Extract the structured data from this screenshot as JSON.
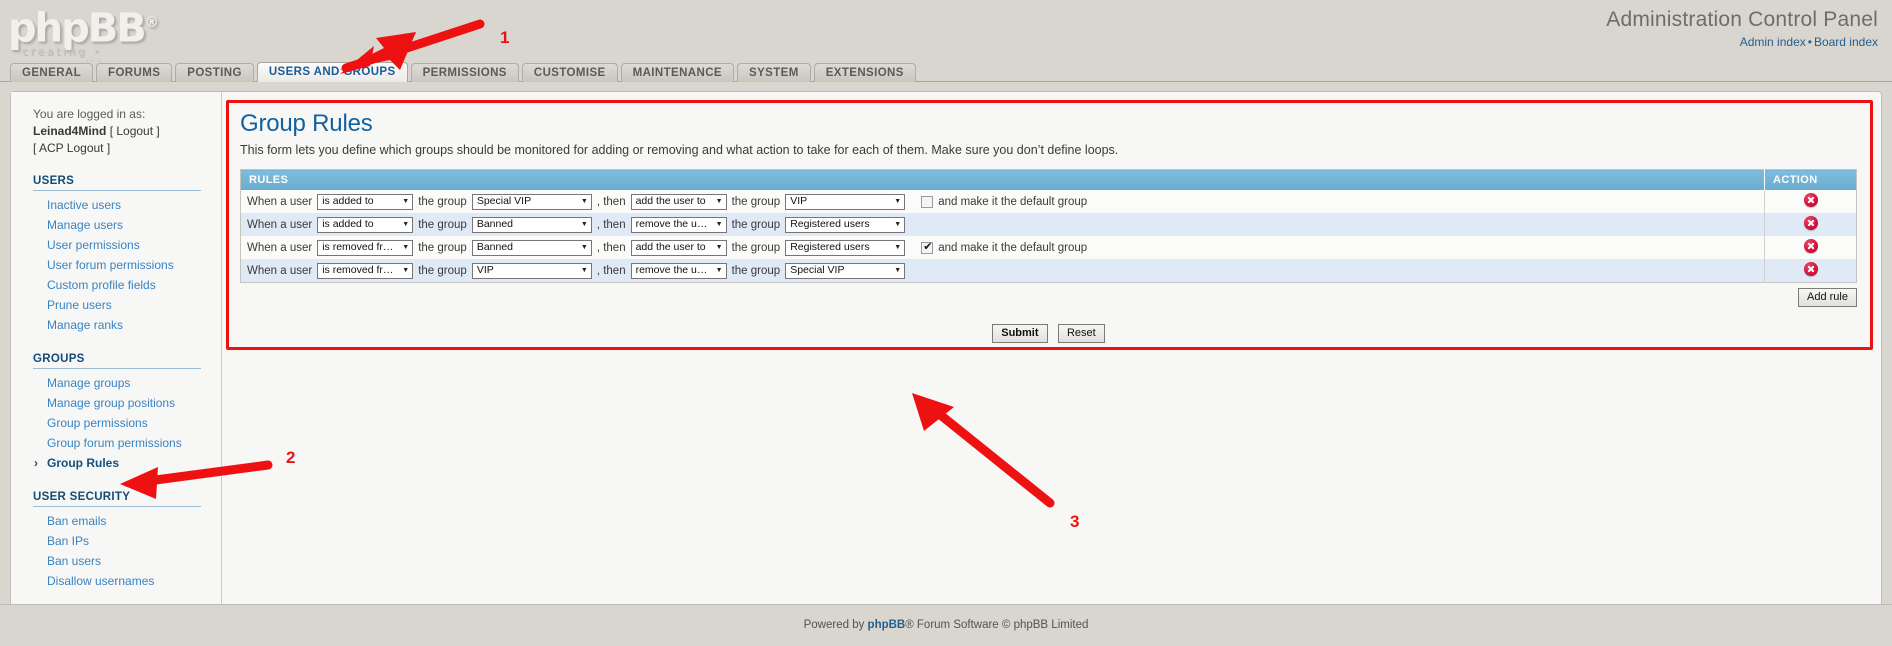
{
  "brand": {
    "logo_text": "phpBB",
    "logo_reg": "®",
    "logo_tagline": "creating • communities"
  },
  "header": {
    "acp_title": "Administration Control Panel",
    "admin_index_link": "Admin index",
    "separator": "•",
    "board_index_link": "Board index"
  },
  "tabs": [
    {
      "label": "GENERAL",
      "active": false
    },
    {
      "label": "FORUMS",
      "active": false
    },
    {
      "label": "POSTING",
      "active": false
    },
    {
      "label": "USERS AND GROUPS",
      "active": true
    },
    {
      "label": "PERMISSIONS",
      "active": false
    },
    {
      "label": "CUSTOMISE",
      "active": false
    },
    {
      "label": "MAINTENANCE",
      "active": false
    },
    {
      "label": "SYSTEM",
      "active": false
    },
    {
      "label": "EXTENSIONS",
      "active": false
    }
  ],
  "sidebar": {
    "logged_in_label": "You are logged in as:",
    "username": "Leinad4Mind",
    "logout_label": "[ Logout ]",
    "acp_logout_label": "[ ACP Logout ]",
    "sections": [
      {
        "title": "USERS",
        "items": [
          {
            "label": "Inactive users",
            "active": false
          },
          {
            "label": "Manage users",
            "active": false
          },
          {
            "label": "User permissions",
            "active": false
          },
          {
            "label": "User forum permissions",
            "active": false
          },
          {
            "label": "Custom profile fields",
            "active": false
          },
          {
            "label": "Prune users",
            "active": false
          },
          {
            "label": "Manage ranks",
            "active": false
          }
        ]
      },
      {
        "title": "GROUPS",
        "items": [
          {
            "label": "Manage groups",
            "active": false
          },
          {
            "label": "Manage group positions",
            "active": false
          },
          {
            "label": "Group permissions",
            "active": false
          },
          {
            "label": "Group forum permissions",
            "active": false
          },
          {
            "label": "Group Rules",
            "active": true
          }
        ]
      },
      {
        "title": "USER SECURITY",
        "items": [
          {
            "label": "Ban emails",
            "active": false
          },
          {
            "label": "Ban IPs",
            "active": false
          },
          {
            "label": "Ban users",
            "active": false
          },
          {
            "label": "Disallow usernames",
            "active": false
          }
        ]
      }
    ]
  },
  "main": {
    "page_title": "Group Rules",
    "page_description": "This form lets you define which groups should be monitored for adding or removing and what action to take for each of them. Make sure you don’t define loops.",
    "table_headers": {
      "rules": "RULES",
      "action": "ACTION"
    },
    "labels": {
      "when_a_user": "When a user",
      "the_group": "the group",
      "then": ", then",
      "the_group_2": "the group",
      "default_group": "and make it the default group"
    },
    "rules": [
      {
        "trigger": "is added to",
        "source_group": "Special VIP",
        "action": "add the user to",
        "target_group": "VIP",
        "show_default_checkbox": true,
        "default_checked": false
      },
      {
        "trigger": "is added to",
        "source_group": "Banned",
        "action": "remove the user from",
        "target_group": "Registered users",
        "show_default_checkbox": false,
        "default_checked": false
      },
      {
        "trigger": "is removed from",
        "source_group": "Banned",
        "action": "add the user to",
        "target_group": "Registered users",
        "show_default_checkbox": true,
        "default_checked": true
      },
      {
        "trigger": "is removed from",
        "source_group": "VIP",
        "action": "remove the user from",
        "target_group": "Special VIP",
        "show_default_checkbox": false,
        "default_checked": false
      }
    ],
    "add_rule_label": "Add rule",
    "submit_label": "Submit",
    "reset_label": "Reset"
  },
  "footer": {
    "text_before": "Powered by ",
    "brand": "phpBB",
    "text_after": "® Forum Software © phpBB Limited"
  },
  "annotations": [
    {
      "number": "1"
    },
    {
      "number": "2"
    },
    {
      "number": "3"
    }
  ],
  "colors": {
    "accent_blue": "#13629f",
    "link_blue": "#3983c4",
    "table_header": "#68abd0",
    "annotation_red": "#ee1111",
    "row_even": "#dfeaf6",
    "page_bg": "#d9d6d0"
  }
}
